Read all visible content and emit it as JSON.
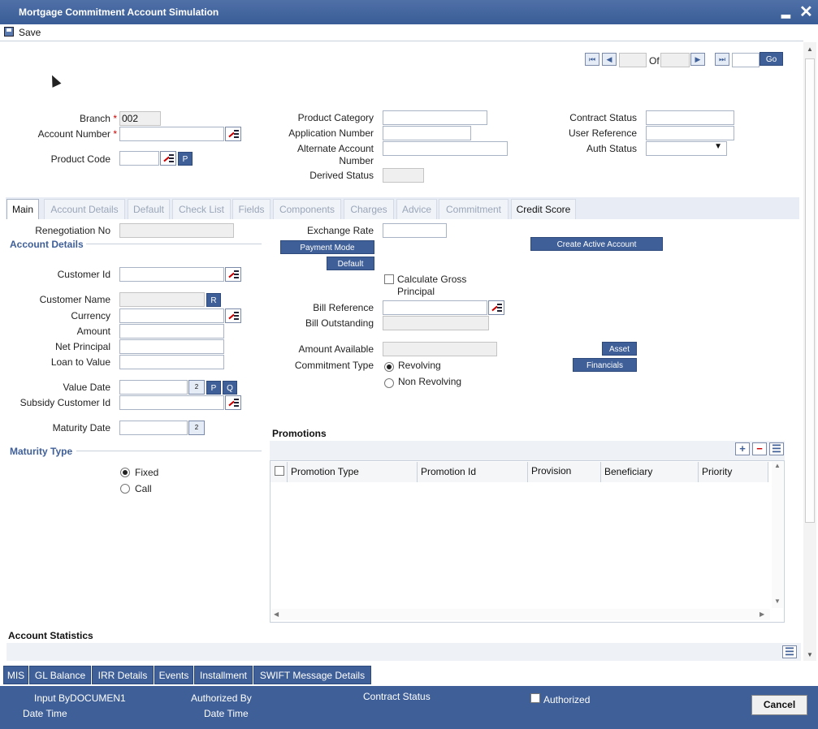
{
  "window": {
    "title": "Mortgage Commitment Account Simulation",
    "minimize": "▂",
    "close": "✕"
  },
  "toolbar": {
    "save_label": "Save"
  },
  "nav": {
    "of_label": "Of",
    "go_label": "Go"
  },
  "header": {
    "branch_label": "Branch",
    "branch_value": "002",
    "account_number_label": "Account Number",
    "product_code_label": "Product Code",
    "product_code_btn": "P",
    "product_category_label": "Product Category",
    "application_number_label": "Application Number",
    "alt_account_label_1": "Alternate Account",
    "alt_account_label_2": "Number",
    "derived_status_label": "Derived Status",
    "contract_status_label": "Contract Status",
    "user_reference_label": "User Reference",
    "auth_status_label": "Auth Status",
    "required_mark": "*"
  },
  "tabs": [
    "Main",
    "Account Details",
    "Default",
    "Check List",
    "Fields",
    "Components",
    "Charges",
    "Advice",
    "Commitment",
    "Credit Score"
  ],
  "main": {
    "renegotiation_label": "Renegotiation No",
    "account_details_title": "Account Details",
    "customer_id_label": "Customer Id",
    "customer_name_label": "Customer Name",
    "customer_name_btn": "R",
    "currency_label": "Currency",
    "amount_label": "Amount",
    "net_principal_label": "Net Principal",
    "loan_to_value_label": "Loan to Value",
    "value_date_label": "Value Date",
    "p_btn": "P",
    "q_btn": "Q",
    "subsidy_customer_label": "Subsidy Customer Id",
    "maturity_date_label": "Maturity Date",
    "maturity_type_title": "Maturity Type",
    "fixed_label": "Fixed",
    "call_label": "Call",
    "exchange_rate_label": "Exchange Rate",
    "payment_mode_btn": "Payment Mode",
    "default_btn": "Default",
    "create_active_btn": "Create Active Account",
    "calc_gross_1": "Calculate Gross",
    "calc_gross_2": "Principal",
    "bill_reference_label": "Bill Reference",
    "bill_outstanding_label": "Bill Outstanding",
    "amount_available_label": "Amount Available",
    "asset_btn": "Asset",
    "commitment_type_label": "Commitment Type",
    "revolving_label": "Revolving",
    "non_revolving_label": "Non Revolving",
    "financials_btn": "Financials",
    "cal_icon": "2"
  },
  "promotions": {
    "title": "Promotions",
    "columns": [
      "Promotion Type",
      "Promotion Id",
      "Provision",
      "Beneficiary",
      "Priority"
    ],
    "add": "+",
    "remove": "−",
    "list": "☰"
  },
  "account_statistics": {
    "title": "Account Statistics",
    "list": "☰"
  },
  "bottom_tabs": [
    "MIS",
    "GL Balance",
    "IRR Details",
    "Events",
    "Installment",
    "SWIFT Message Details"
  ],
  "footer": {
    "input_by": "Input ByDOCUMEN1",
    "date_time": "Date Time",
    "authorized_by": "Authorized By",
    "date_time_2": "Date Time",
    "contract_status": "Contract Status",
    "authorized": "Authorized",
    "cancel": "Cancel"
  }
}
